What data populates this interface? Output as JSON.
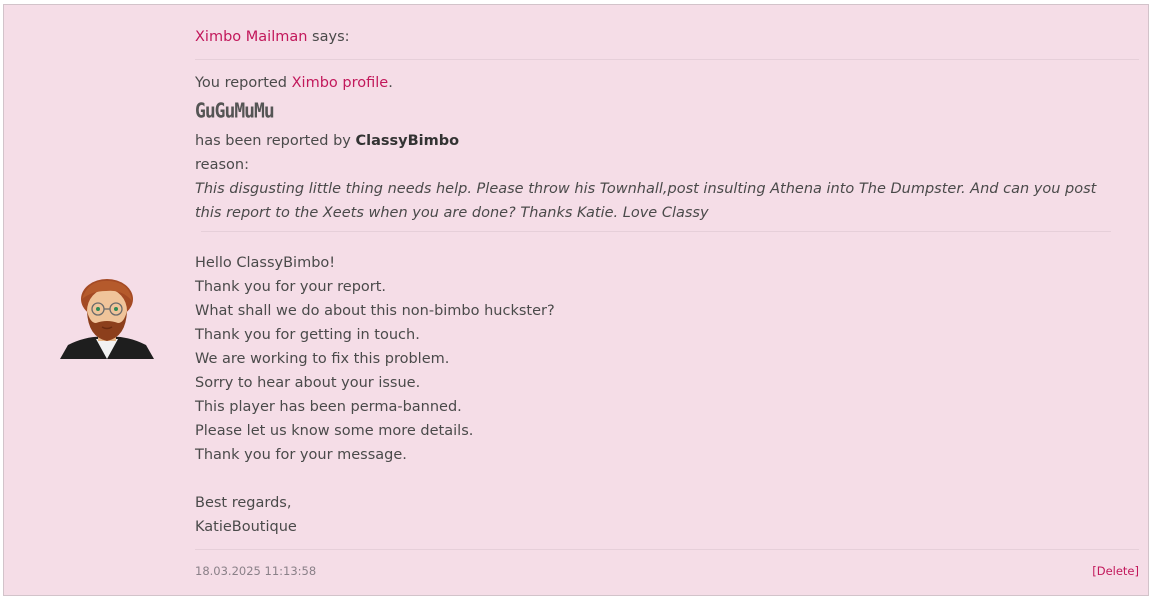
{
  "message": {
    "sender": "Ximbo Mailman",
    "says": "says:",
    "reported_prefix": "You reported",
    "reported_link": "Ximbo profile",
    "reported_suffix": ".",
    "reported_name": "GuGuMuMu",
    "reported_by_prefix": "has been reported by",
    "reported_by": "ClassyBimbo",
    "reason_label": "reason:",
    "reason_text": "This disgusting little thing needs help. Please throw his Townhall,post insulting Athena into The Dumpster. And can you post this report to the Xeets when you are done? Thanks Katie. Love Classy",
    "reply_lines": [
      "Hello ClassyBimbo!",
      "Thank you for your report.",
      "What shall we do about this non-bimbo huckster?",
      "Thank you for getting in touch.",
      "We are working to fix this problem.",
      "Sorry to hear about your issue.",
      "This player has been perma-banned.",
      "Please let us know some more details.",
      "Thank you for your message."
    ],
    "signoff": "Best regards,",
    "signature": "KatieBoutique",
    "timestamp": "18.03.2025 11:13:58",
    "delete_label": "[Delete]"
  },
  "colors": {
    "link": "#c2185b",
    "background": "#f5dde7"
  },
  "icons": {
    "avatar": "bearded-man-avatar"
  }
}
